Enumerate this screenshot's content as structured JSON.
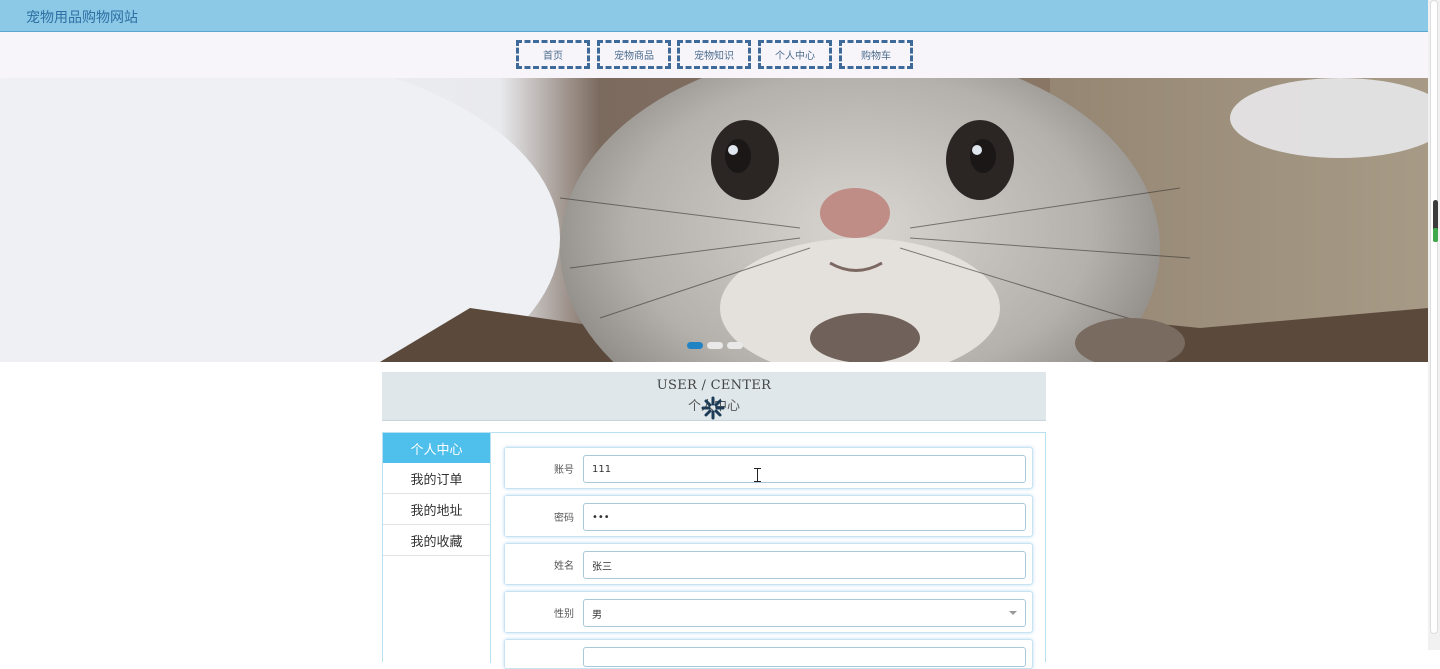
{
  "site": {
    "title": "宠物用品购物网站"
  },
  "nav": [
    {
      "label": "首页"
    },
    {
      "label": "宠物商品"
    },
    {
      "label": "宠物知识"
    },
    {
      "label": "个人中心"
    },
    {
      "label": "购物车"
    }
  ],
  "banner": {
    "active_slide": 1,
    "slide_count": 3
  },
  "section": {
    "title_en": "USER / CENTER",
    "title_cn": "个人中心"
  },
  "sidebar": [
    {
      "label": "个人中心",
      "active": true
    },
    {
      "label": "我的订单",
      "active": false
    },
    {
      "label": "我的地址",
      "active": false
    },
    {
      "label": "我的收藏",
      "active": false
    }
  ],
  "form": {
    "account": {
      "label": "账号",
      "value": "111"
    },
    "password": {
      "label": "密码",
      "value": "•••"
    },
    "name": {
      "label": "姓名",
      "value": "张三"
    },
    "gender": {
      "label": "性别",
      "value": "男"
    }
  },
  "colors": {
    "topbar": "#8bc9e7",
    "nav_border": "#3d6a99",
    "sidebar_active": "#4fc0ec"
  }
}
